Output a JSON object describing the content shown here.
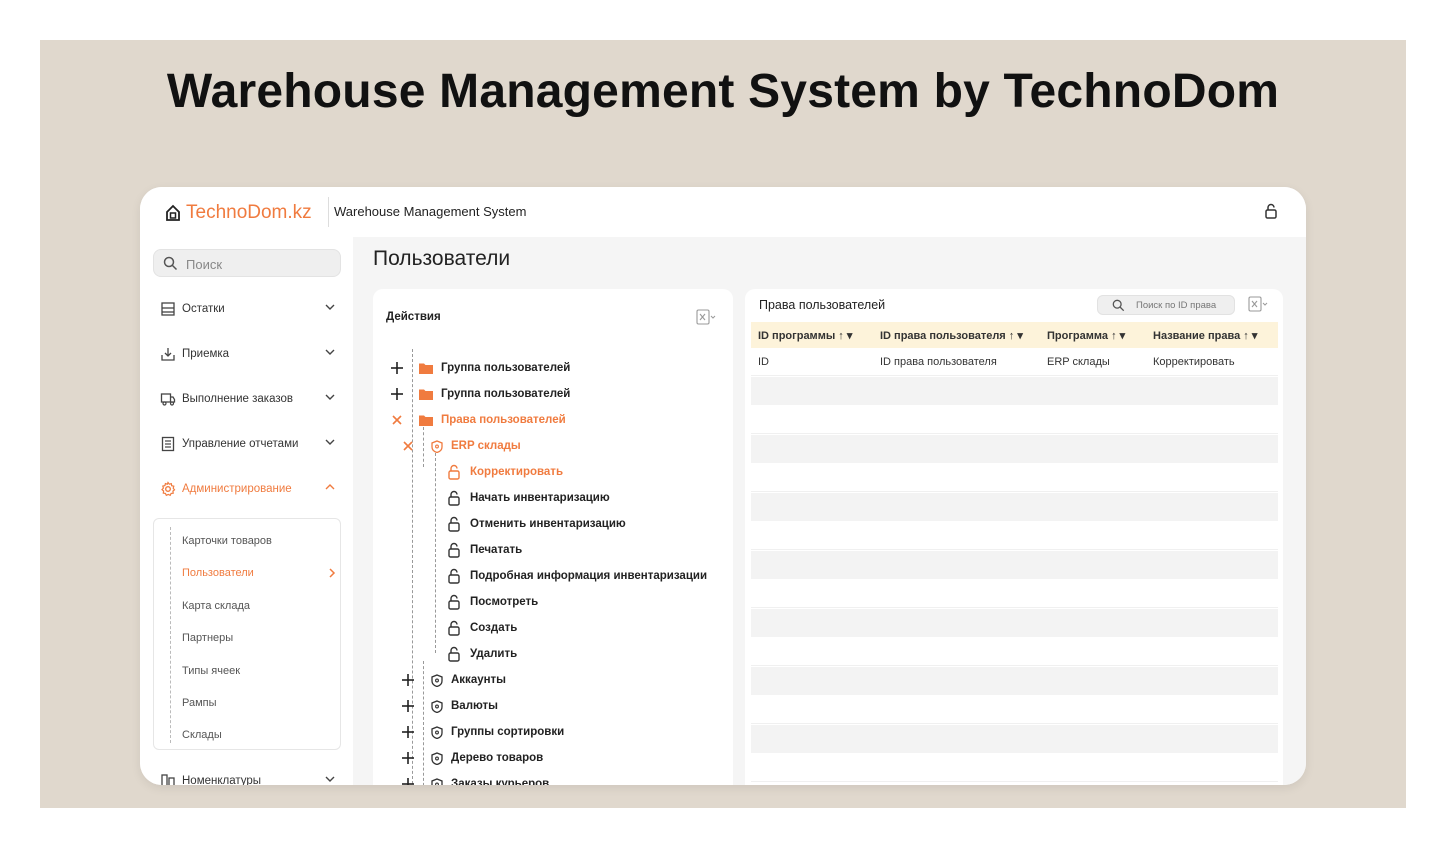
{
  "hero": {
    "title": "Warehouse Management System by TechnoDom"
  },
  "app": {
    "logo_main": "TechnoDom",
    "logo_suffix": ".kz",
    "title": "Warehouse Management System",
    "accent": "#f07b3f"
  },
  "sidebar": {
    "search_placeholder": "Поиск",
    "items": [
      {
        "label": "Остатки",
        "icon": "shelf-icon"
      },
      {
        "label": "Приемка",
        "icon": "receiving-icon"
      },
      {
        "label": "Выполнение заказов",
        "icon": "truck-icon"
      },
      {
        "label": "Управление отчетами",
        "icon": "report-icon"
      },
      {
        "label": "Администрирование",
        "icon": "gear-icon",
        "active": true
      },
      {
        "label": "Номенклатуры",
        "icon": "catalog-icon"
      }
    ],
    "submenu": [
      {
        "label": "Карточки товаров"
      },
      {
        "label": "Пользователи",
        "active": true
      },
      {
        "label": "Карта склада"
      },
      {
        "label": "Партнеры"
      },
      {
        "label": "Типы ячеек"
      },
      {
        "label": "Рампы"
      },
      {
        "label": "Склады"
      }
    ]
  },
  "main": {
    "page_title": "Пользователи",
    "actions_panel": {
      "title": "Действия",
      "tree": [
        {
          "label": "Группа пользователей",
          "type": "folder",
          "toggle": "plus"
        },
        {
          "label": "Группа пользователей",
          "type": "folder",
          "toggle": "plus"
        },
        {
          "label": "Права пользователей",
          "type": "folder",
          "toggle": "close",
          "orange": true
        },
        {
          "label": "ERP склады",
          "type": "shield",
          "toggle": "close",
          "orange": true
        },
        {
          "label": "Корректировать",
          "type": "lock",
          "orange": true
        },
        {
          "label": "Начать инвентаризацию",
          "type": "lock"
        },
        {
          "label": "Отменить инвентаризацию",
          "type": "lock"
        },
        {
          "label": "Печатать",
          "type": "lock"
        },
        {
          "label": "Подробная информация инвентаризации",
          "type": "lock"
        },
        {
          "label": "Посмотреть",
          "type": "lock"
        },
        {
          "label": "Создать",
          "type": "lock"
        },
        {
          "label": "Удалить",
          "type": "lock"
        },
        {
          "label": "Аккаунты",
          "type": "shield",
          "toggle": "plus"
        },
        {
          "label": "Валюты",
          "type": "shield",
          "toggle": "plus"
        },
        {
          "label": "Группы сортировки",
          "type": "shield",
          "toggle": "plus"
        },
        {
          "label": "Дерево товаров",
          "type": "shield",
          "toggle": "plus"
        },
        {
          "label": "Заказы курьеров",
          "type": "shield",
          "toggle": "plus"
        }
      ]
    },
    "rights_panel": {
      "title": "Права пользователей",
      "search_placeholder": "Поиск по ID права",
      "columns": [
        "ID программы",
        "ID права пользователя",
        "Программа",
        "Название права"
      ],
      "rows": [
        [
          "ID",
          "ID права пользователя",
          "ERP склады",
          "Корректировать"
        ]
      ]
    }
  }
}
